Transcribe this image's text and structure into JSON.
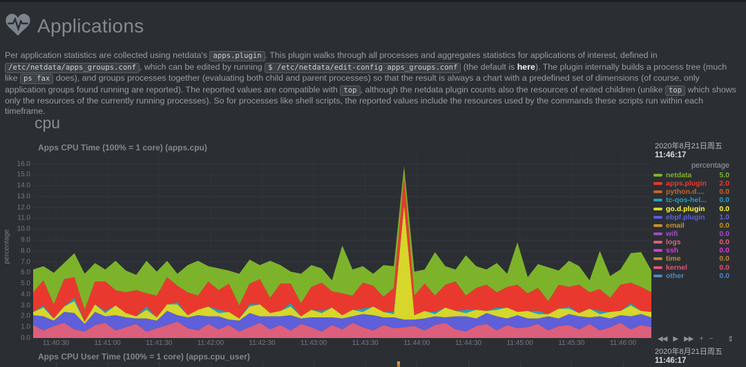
{
  "page": {
    "app_title": "Applications"
  },
  "intro": {
    "segments": [
      {
        "type": "text",
        "text": "Per application statistics are collected using netdata's "
      },
      {
        "type": "code",
        "text": "apps.plugin"
      },
      {
        "type": "text",
        "text": ". This plugin walks through all processes and aggregates statistics for applications of interest, defined in "
      },
      {
        "type": "code",
        "text": "/etc/netdata/apps_groups.conf"
      },
      {
        "type": "text",
        "text": ", which can be edited by running "
      },
      {
        "type": "code",
        "text": "$ /etc/netdata/edit-config apps_groups.conf"
      },
      {
        "type": "text",
        "text": " (the default is "
      },
      {
        "type": "link",
        "text": "here"
      },
      {
        "type": "text",
        "text": "). The plugin internally builds a process tree (much like "
      },
      {
        "type": "code",
        "text": "ps fax"
      },
      {
        "type": "text",
        "text": " does), and groups processes together (evaluating both child and parent processes) so that the result is always a chart with a predefined set of dimensions (of course, only application groups found running are reported). The reported values are compatible with "
      },
      {
        "type": "code",
        "text": "top"
      },
      {
        "type": "text",
        "text": ", although the netdata plugin counts also the resources of exited children (unlike "
      },
      {
        "type": "code",
        "text": "top"
      },
      {
        "type": "text",
        "text": " which shows only the resources of the currently running processes). So for processes like shell scripts, the reported values include the resources used by the commands these scripts run within each timeframe."
      }
    ]
  },
  "section": {
    "heading": "cpu"
  },
  "chart1": {
    "title": "Apps CPU Time (100% = 1 core) (apps.cpu)",
    "date": "2020年8月21日周五",
    "time": "11:46:17",
    "legend": {
      "header": "percentage",
      "items": [
        {
          "label": "netdata",
          "value": "5.0",
          "color": "#7db32a",
          "emphasis": false
        },
        {
          "label": "apps.plugin",
          "value": "2.0",
          "color": "#e9392f",
          "emphasis": false
        },
        {
          "label": "python.d....",
          "value": "0.0",
          "color": "#c4642b",
          "emphasis": false
        },
        {
          "label": "tc-qos-hel...",
          "value": "0.0",
          "color": "#26a0bb",
          "emphasis": false
        },
        {
          "label": "go.d.plugin",
          "value": "0.0",
          "color": "#d6d62b",
          "emphasis": true
        },
        {
          "label": "ebpf.plugin",
          "value": "1.0",
          "color": "#5e5fd9",
          "emphasis": false
        },
        {
          "label": "email",
          "value": "0.0",
          "color": "#c7912e",
          "emphasis": false
        },
        {
          "label": "wifi",
          "value": "0.0",
          "color": "#a04cc5",
          "emphasis": false
        },
        {
          "label": "logs",
          "value": "0.0",
          "color": "#e0607a",
          "emphasis": false
        },
        {
          "label": "ssh",
          "value": "0.0",
          "color": "#d939d9",
          "emphasis": false
        },
        {
          "label": "time",
          "value": "0.0",
          "color": "#c08a2d",
          "emphasis": false
        },
        {
          "label": "kernel",
          "value": "0.0",
          "color": "#e05577",
          "emphasis": false
        },
        {
          "label": "other",
          "value": "0.0",
          "color": "#4f88c0",
          "emphasis": false
        }
      ]
    },
    "toolbar": [
      {
        "name": "pan-backward",
        "glyph": "◀◀"
      },
      {
        "name": "play",
        "glyph": "▶"
      },
      {
        "name": "pan-forward",
        "glyph": "▶▶"
      },
      {
        "name": "zoom-in",
        "glyph": "+"
      },
      {
        "name": "zoom-out",
        "glyph": "−"
      },
      {
        "name": "resize",
        "glyph": "⇕"
      }
    ]
  },
  "chart_data": {
    "type": "area",
    "stacked": true,
    "title": "Apps CPU Time (100% = 1 core) (apps.cpu)",
    "ylabel": "percentage",
    "ylim": [
      0,
      16.8
    ],
    "grid": true,
    "legend_position": "right",
    "x_start": "11:40:17",
    "x_end": "11:46:17",
    "xticks": [
      "11:40:30",
      "11:41:00",
      "11:41:30",
      "11:42:00",
      "11:42:30",
      "11:43:00",
      "11:43:30",
      "11:44:00",
      "11:44:30",
      "11:45:00",
      "11:45:30",
      "11:46:00"
    ],
    "yticks": [
      "0.0",
      "1.0",
      "2.0",
      "3.0",
      "4.0",
      "5.0",
      "6.0",
      "7.0",
      "8.0",
      "9.0",
      "10.0",
      "11.0",
      "12.0",
      "13.0",
      "14.0",
      "15.0",
      "16.0"
    ],
    "series": [
      {
        "name": "logs",
        "color": "#dc5f7b",
        "values": [
          1.2,
          0.7,
          1.1,
          1.4,
          0.8,
          0.6,
          1.2,
          1.4,
          0.7,
          1.0,
          1.3,
          0.6,
          0.9,
          1.2,
          1.5,
          0.9,
          0.7,
          1.3,
          0.8,
          1.2,
          0.6,
          1.0,
          1.4,
          0.8,
          1.2,
          0.7,
          1.3,
          1.0,
          0.6,
          1.2,
          0.8,
          1.4,
          1.0,
          0.7,
          1.2,
          0.9,
          1.0,
          1.1,
          0.7,
          1.2,
          1.4,
          0.8,
          0.6,
          1.1,
          1.3,
          0.7,
          1.2,
          0.9,
          1.0,
          1.3,
          0.7,
          1.1,
          1.2,
          0.8,
          1.3,
          0.7,
          1.0,
          1.4,
          0.8,
          1.2,
          1.0
        ]
      },
      {
        "name": "ebpf.plugin",
        "color": "#5e5fd9",
        "values": [
          0.9,
          1.3,
          0.5,
          1.0,
          1.5,
          0.7,
          1.2,
          0.6,
          1.4,
          0.9,
          0.5,
          1.2,
          0.7,
          1.3,
          0.6,
          1.0,
          1.4,
          0.7,
          1.2,
          0.5,
          1.0,
          1.3,
          0.6,
          1.2,
          0.8,
          1.4,
          0.5,
          0.9,
          1.3,
          0.7,
          1.0,
          0.6,
          1.2,
          1.4,
          0.7,
          1.0,
          0.7,
          0.6,
          1.1,
          0.8,
          0.5,
          1.2,
          1.4,
          0.7,
          1.0,
          1.3,
          0.6,
          1.2,
          0.8,
          0.5,
          1.3,
          0.7,
          1.0,
          1.2,
          0.6,
          1.3,
          0.8,
          0.7,
          1.2,
          1.0,
          0.9
        ]
      },
      {
        "name": "go.d.plugin",
        "color": "#d6d62b",
        "values": [
          0.3,
          0.8,
          0.2,
          0.5,
          1.1,
          0.2,
          0.7,
          0.3,
          0.9,
          0.4,
          0.2,
          0.8,
          0.3,
          0.6,
          1.0,
          0.2,
          0.5,
          0.9,
          0.3,
          0.7,
          0.2,
          0.6,
          1.1,
          0.3,
          0.5,
          0.8,
          0.2,
          0.7,
          0.4,
          0.9,
          0.3,
          0.6,
          0.2,
          0.8,
          0.5,
          0.3,
          10.5,
          0.4,
          0.7,
          0.2,
          0.9,
          0.5,
          0.3,
          0.8,
          0.2,
          0.6,
          1.0,
          0.3,
          0.7,
          0.4,
          0.2,
          0.9,
          0.5,
          0.3,
          0.8,
          0.2,
          0.6,
          0.4,
          1.0,
          0.3,
          0.5
        ]
      },
      {
        "name": "tc-qos-helper",
        "color": "#26a0bb",
        "values": [
          0,
          0.2,
          0,
          0,
          0.3,
          0,
          0,
          0.2,
          0,
          0,
          0,
          0.3,
          0,
          0,
          0.2,
          0,
          0,
          0,
          0.3,
          0,
          0,
          0.2,
          0,
          0,
          0,
          0.3,
          0,
          0,
          0.2,
          0,
          0,
          0,
          0.3,
          0,
          0,
          0.2,
          0,
          0,
          0,
          0.2,
          0,
          0,
          0.3,
          0,
          0,
          0.2,
          0,
          0,
          0,
          0.3,
          0,
          0,
          0.2,
          0,
          0,
          0.3,
          0,
          0,
          0.2,
          0,
          0
        ]
      },
      {
        "name": "apps.plugin",
        "color": "#e9392f",
        "values": [
          1.8,
          2.3,
          1.3,
          2.5,
          1.9,
          1.1,
          2.1,
          2.7,
          1.4,
          1.9,
          2.4,
          1.2,
          2.0,
          2.5,
          1.5,
          2.1,
          1.3,
          2.3,
          1.8,
          2.6,
          1.2,
          1.9,
          2.3,
          1.4,
          2.5,
          1.8,
          1.2,
          2.1,
          2.6,
          1.5,
          2.0,
          1.3,
          2.4,
          1.9,
          1.4,
          2.2,
          2.6,
          1.8,
          2.5,
          1.5,
          2.1,
          2.7,
          1.3,
          2.0,
          2.4,
          1.4,
          1.9,
          2.5,
          1.6,
          2.1,
          1.2,
          2.2,
          1.8,
          2.6,
          1.5,
          2.0,
          1.3,
          2.4,
          1.9,
          2.2,
          1.8
        ]
      },
      {
        "name": "netdata",
        "color": "#7db32a",
        "values": [
          2.1,
          1.3,
          2.9,
          1.5,
          2.2,
          3.3,
          1.7,
          1.1,
          2.7,
          2.0,
          1.4,
          3.0,
          2.2,
          1.5,
          1.1,
          2.5,
          3.2,
          1.4,
          2.0,
          1.2,
          2.9,
          2.2,
          1.3,
          3.4,
          1.7,
          1.1,
          2.7,
          2.0,
          1.3,
          1.0,
          4.4,
          2.4,
          1.5,
          1.1,
          2.9,
          2.0,
          1.0,
          2.2,
          1.3,
          4.0,
          1.7,
          1.1,
          3.7,
          2.0,
          1.4,
          2.7,
          1.2,
          3.9,
          1.5,
          2.2,
          3.1,
          1.3,
          2.4,
          1.7,
          1.1,
          3.5,
          2.0,
          1.4,
          2.7,
          3.2,
          2.0
        ]
      }
    ]
  },
  "chart2": {
    "title": "Apps CPU User Time (100% = 1 core) (apps.cpu_user)",
    "date": "2020年8月21日周五",
    "time": "11:46:17"
  }
}
